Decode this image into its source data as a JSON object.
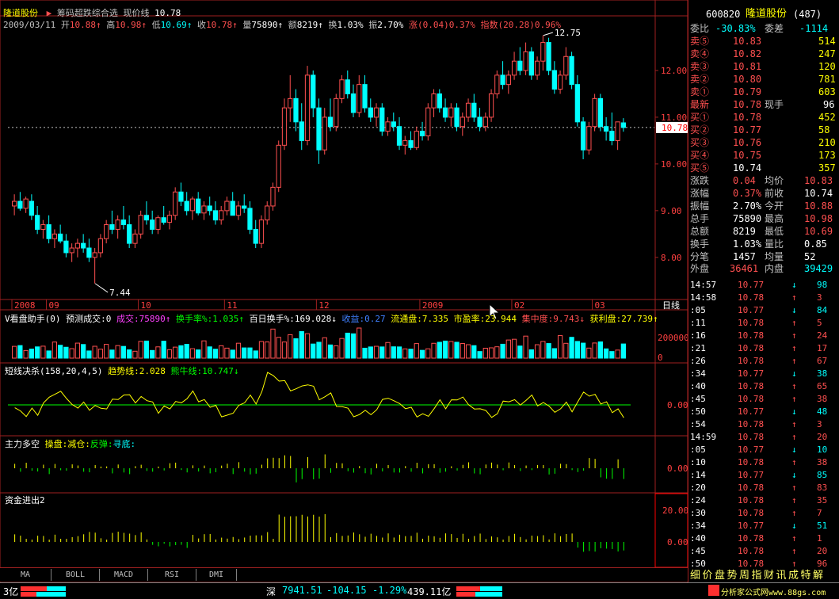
{
  "header": {
    "stock_name": "隆道股份",
    "arrow": "▶",
    "formula_name": "筹码超跌综合选",
    "price_line_label": "现价线",
    "price_line_value": "10.78",
    "date": "2009/03/11",
    "open_label": "开",
    "open": "10.88",
    "high_label": "高",
    "high": "10.98",
    "low_label": "低",
    "low": "10.69",
    "close_label": "收",
    "close": "10.78",
    "vol_label": "量",
    "vol": "75890",
    "amt_label": "额",
    "amt": "8219",
    "turn_label": "换",
    "turn": "1.03%",
    "amp_label": "振",
    "amp": "2.70%",
    "chg_label": "涨",
    "chg": "(0.04)0.37%",
    "idx_label": "指数",
    "idx": "(20.28)0.96%"
  },
  "price_axis": {
    "labels": [
      "12.00",
      "11.00",
      "10.00",
      "9.00",
      "8.00"
    ],
    "current": "10.78"
  },
  "annotations": {
    "high": "12.75",
    "low": "7.44"
  },
  "date_axis": {
    "labels": [
      "2008",
      "09",
      "10",
      "11",
      "12",
      "2009",
      "02",
      "03"
    ],
    "period": "日线"
  },
  "vol_indicator": {
    "name": "V看盘助手(0)",
    "pred_label": "预测成交:0",
    "vol_text": "成交:75890",
    "turn_text": "换手率%:1.035",
    "hundred_text": "百日换手%:169.028",
    "profit_text": "收益:0.27",
    "float_text": "流通盘:7.335",
    "pe_text": "市盈率:23.944",
    "conc_text": "集中度:9.743",
    "win_text": "获利盘:27.739",
    "axis": [
      "200000",
      "0"
    ]
  },
  "short_indicator": {
    "name": "短线决杀(158,20,4,5)",
    "trend_text": "趋势线:2.028",
    "bull_text": "熊牛线:10.747",
    "axis": [
      "0.00"
    ]
  },
  "main_force": {
    "name": "主力多空",
    "legend_a": "操盘:",
    "legend_b": "减仓:",
    "legend_c": "反弹:",
    "legend_d": "寻底:",
    "axis": [
      "0.00"
    ]
  },
  "capital_flow": {
    "name": "资金进出2",
    "axis": [
      "20.00",
      "0.00"
    ]
  },
  "tabs": [
    "MA",
    "BOLL",
    "MACD",
    "RSI",
    "DMI"
  ],
  "quote_panel": {
    "code": "600820",
    "name": "隆道股份",
    "count": "(487)",
    "ratio_label": "委比",
    "ratio": "-30.83%",
    "diff_label": "委差",
    "diff": "-1114",
    "asks": [
      {
        "label": "卖⑤",
        "price": "10.83",
        "vol": "514"
      },
      {
        "label": "卖④",
        "price": "10.82",
        "vol": "247"
      },
      {
        "label": "卖③",
        "price": "10.81",
        "vol": "120"
      },
      {
        "label": "卖②",
        "price": "10.80",
        "vol": "781"
      },
      {
        "label": "卖①",
        "price": "10.79",
        "vol": "603"
      }
    ],
    "last_label": "最新",
    "last": "10.78",
    "hand_label": "现手",
    "hand": "96",
    "bids": [
      {
        "label": "买①",
        "price": "10.78",
        "vol": "452"
      },
      {
        "label": "买②",
        "price": "10.77",
        "vol": "58"
      },
      {
        "label": "买③",
        "price": "10.76",
        "vol": "210"
      },
      {
        "label": "买④",
        "price": "10.75",
        "vol": "173"
      },
      {
        "label": "买⑤",
        "price": "10.74",
        "vol": "357"
      }
    ],
    "stats": [
      {
        "l1": "涨跌",
        "v1": "0.04",
        "l2": "均价",
        "v2": "10.83"
      },
      {
        "l1": "涨幅",
        "v1": "0.37%",
        "l2": "前收",
        "v2": "10.74"
      },
      {
        "l1": "振幅",
        "v1": "2.70%",
        "l2": "今开",
        "v2": "10.88"
      },
      {
        "l1": "总手",
        "v1": "75890",
        "l2": "最高",
        "v2": "10.98"
      },
      {
        "l1": "总额",
        "v1": "8219",
        "l2": "最低",
        "v2": "10.69"
      },
      {
        "l1": "换手",
        "v1": "1.03%",
        "l2": "量比",
        "v2": "0.85"
      },
      {
        "l1": "分笔",
        "v1": "1457",
        "l2": "均量",
        "v2": "52"
      }
    ],
    "outer_label": "外盘",
    "outer": "36461",
    "inner_label": "内盘",
    "inner": "39429"
  },
  "ticks": [
    {
      "t": "14:57",
      "p": "10.77",
      "d": "↓",
      "v": "98"
    },
    {
      "t": "14:58",
      "p": "10.78",
      "d": "↑",
      "v": "3"
    },
    {
      "t": ":05",
      "p": "10.77",
      "d": "↓",
      "v": "84"
    },
    {
      "t": ":11",
      "p": "10.78",
      "d": "↑",
      "v": "5"
    },
    {
      "t": ":16",
      "p": "10.78",
      "d": "↑",
      "v": "24"
    },
    {
      "t": ":21",
      "p": "10.78",
      "d": "↑",
      "v": "17"
    },
    {
      "t": ":26",
      "p": "10.78",
      "d": "↑",
      "v": "67"
    },
    {
      "t": ":34",
      "p": "10.77",
      "d": "↓",
      "v": "38"
    },
    {
      "t": ":40",
      "p": "10.78",
      "d": "↑",
      "v": "65"
    },
    {
      "t": ":45",
      "p": "10.78",
      "d": "↑",
      "v": "38"
    },
    {
      "t": ":50",
      "p": "10.77",
      "d": "↓",
      "v": "48"
    },
    {
      "t": ":54",
      "p": "10.78",
      "d": "↑",
      "v": "3"
    },
    {
      "t": "14:59",
      "p": "10.78",
      "d": "↑",
      "v": "20"
    },
    {
      "t": ":05",
      "p": "10.77",
      "d": "↓",
      "v": "10"
    },
    {
      "t": ":10",
      "p": "10.78",
      "d": "↑",
      "v": "38"
    },
    {
      "t": ":14",
      "p": "10.77",
      "d": "↓",
      "v": "85"
    },
    {
      "t": ":20",
      "p": "10.78",
      "d": "↑",
      "v": "83"
    },
    {
      "t": ":24",
      "p": "10.78",
      "d": "↑",
      "v": "35"
    },
    {
      "t": ":30",
      "p": "10.78",
      "d": "↑",
      "v": "7"
    },
    {
      "t": ":34",
      "p": "10.77",
      "d": "↓",
      "v": "51"
    },
    {
      "t": ":40",
      "p": "10.78",
      "d": "↑",
      "v": "1"
    },
    {
      "t": ":45",
      "p": "10.78",
      "d": "↑",
      "v": "20"
    },
    {
      "t": ":50",
      "p": "10.78",
      "d": "↑",
      "v": "96"
    }
  ],
  "bottom_tabs": [
    "细",
    "价",
    "盘",
    "势",
    "周",
    "指",
    "财",
    "讯",
    "成",
    "特",
    "解"
  ],
  "status": {
    "left": "3亿",
    "market": "深",
    "index": "7941.51",
    "change": "-104.15",
    "pct": "-1.29%",
    "turnover": "439.11亿",
    "site": "分析家公式网www.88gs.com"
  },
  "colors": {
    "up": "#ff5050",
    "down": "#00ffff",
    "grid": "#a02020",
    "yellow": "#ffff00",
    "green": "#00ff00"
  },
  "chart_data": {
    "type": "candlestick",
    "price_range": [
      7.2,
      13.0
    ],
    "candles": [
      [
        9.1,
        9.35,
        8.9,
        9.2
      ],
      [
        9.2,
        9.4,
        9.0,
        9.05
      ],
      [
        9.05,
        9.3,
        8.95,
        9.25
      ],
      [
        9.2,
        9.35,
        8.8,
        8.9
      ],
      [
        8.9,
        9.1,
        8.5,
        8.6
      ],
      [
        8.6,
        8.8,
        8.4,
        8.7
      ],
      [
        8.7,
        8.9,
        8.3,
        8.4
      ],
      [
        8.4,
        8.6,
        8.2,
        8.5
      ],
      [
        8.5,
        8.7,
        8.3,
        8.35
      ],
      [
        8.35,
        8.5,
        8.0,
        8.1
      ],
      [
        8.1,
        8.3,
        7.9,
        8.2
      ],
      [
        8.2,
        8.4,
        8.0,
        8.3
      ],
      [
        8.3,
        8.5,
        8.1,
        8.2
      ],
      [
        8.2,
        8.4,
        7.9,
        8.0
      ],
      [
        8.0,
        8.2,
        7.44,
        8.1
      ],
      [
        8.1,
        8.5,
        8.0,
        8.4
      ],
      [
        8.4,
        8.8,
        8.3,
        8.7
      ],
      [
        8.7,
        9.0,
        8.5,
        8.6
      ],
      [
        8.6,
        8.9,
        8.4,
        8.8
      ],
      [
        8.8,
        9.1,
        8.6,
        8.7
      ],
      [
        8.7,
        8.9,
        8.2,
        8.3
      ],
      [
        8.3,
        8.6,
        8.2,
        8.5
      ],
      [
        8.5,
        9.0,
        8.4,
        8.9
      ],
      [
        8.9,
        9.2,
        8.7,
        8.8
      ],
      [
        8.8,
        9.0,
        8.5,
        8.6
      ],
      [
        8.6,
        8.9,
        8.5,
        8.85
      ],
      [
        8.85,
        9.1,
        8.7,
        8.75
      ],
      [
        8.75,
        9.0,
        8.6,
        8.9
      ],
      [
        8.9,
        9.5,
        8.8,
        9.4
      ],
      [
        9.4,
        9.6,
        9.1,
        9.2
      ],
      [
        9.2,
        9.4,
        8.9,
        9.0
      ],
      [
        9.0,
        9.3,
        8.8,
        9.25
      ],
      [
        9.25,
        9.4,
        8.9,
        8.95
      ],
      [
        8.95,
        9.2,
        8.8,
        9.1
      ],
      [
        9.1,
        9.3,
        8.9,
        9.0
      ],
      [
        9.0,
        9.2,
        8.7,
        8.8
      ],
      [
        8.8,
        9.1,
        8.7,
        9.0
      ],
      [
        9.0,
        9.3,
        8.9,
        9.2
      ],
      [
        9.2,
        9.4,
        8.9,
        8.9
      ],
      [
        8.9,
        9.2,
        8.8,
        9.1
      ],
      [
        9.1,
        9.35,
        8.95,
        9.05
      ],
      [
        9.05,
        9.2,
        8.5,
        8.6
      ],
      [
        8.6,
        8.8,
        8.2,
        8.3
      ],
      [
        8.3,
        8.9,
        8.2,
        8.8
      ],
      [
        8.8,
        9.2,
        8.7,
        9.1
      ],
      [
        9.1,
        9.6,
        9.0,
        9.5
      ],
      [
        9.5,
        10.5,
        9.4,
        10.4
      ],
      [
        10.4,
        11.4,
        10.3,
        11.2
      ],
      [
        11.2,
        11.9,
        10.9,
        11.4
      ],
      [
        11.4,
        11.6,
        10.7,
        10.9
      ],
      [
        10.9,
        11.3,
        10.3,
        10.5
      ],
      [
        10.5,
        12.1,
        10.4,
        11.9
      ],
      [
        11.9,
        12.0,
        11.0,
        11.2
      ],
      [
        11.2,
        11.4,
        10.0,
        10.3
      ],
      [
        10.3,
        11.2,
        10.2,
        11.0
      ],
      [
        11.0,
        11.4,
        10.7,
        10.8
      ],
      [
        10.8,
        11.5,
        10.7,
        11.4
      ],
      [
        11.4,
        11.9,
        11.3,
        11.8
      ],
      [
        11.8,
        12.0,
        11.4,
        11.5
      ],
      [
        11.5,
        11.7,
        11.0,
        11.1
      ],
      [
        11.1,
        11.9,
        11.0,
        11.7
      ],
      [
        11.7,
        11.9,
        11.1,
        11.2
      ],
      [
        11.2,
        11.4,
        10.9,
        11.0
      ],
      [
        11.0,
        11.3,
        10.8,
        11.2
      ],
      [
        11.2,
        11.3,
        10.6,
        10.7
      ],
      [
        10.7,
        11.0,
        10.6,
        10.9
      ],
      [
        10.9,
        11.1,
        10.7,
        10.8
      ],
      [
        10.8,
        11.0,
        10.3,
        10.4
      ],
      [
        10.4,
        10.6,
        10.2,
        10.5
      ],
      [
        10.5,
        10.7,
        10.3,
        10.35
      ],
      [
        10.35,
        10.8,
        10.3,
        10.7
      ],
      [
        10.7,
        10.9,
        10.5,
        10.6
      ],
      [
        10.6,
        11.3,
        10.5,
        11.2
      ],
      [
        11.2,
        11.6,
        11.0,
        11.5
      ],
      [
        11.5,
        11.6,
        11.1,
        11.2
      ],
      [
        11.2,
        11.4,
        10.9,
        11.0
      ],
      [
        11.0,
        11.3,
        10.8,
        11.2
      ],
      [
        11.2,
        11.3,
        10.7,
        10.8
      ],
      [
        10.8,
        11.1,
        10.6,
        11.0
      ],
      [
        11.0,
        11.4,
        10.9,
        11.3
      ],
      [
        11.3,
        11.5,
        10.9,
        11.0
      ],
      [
        11.0,
        11.2,
        10.7,
        10.8
      ],
      [
        10.8,
        11.1,
        10.7,
        11.0
      ],
      [
        11.0,
        11.6,
        10.9,
        11.5
      ],
      [
        11.5,
        12.0,
        11.4,
        11.9
      ],
      [
        11.9,
        12.2,
        11.6,
        11.7
      ],
      [
        11.7,
        12.0,
        11.5,
        11.9
      ],
      [
        11.9,
        12.4,
        11.8,
        12.2
      ],
      [
        12.2,
        12.5,
        11.9,
        12.0
      ],
      [
        12.0,
        12.6,
        11.9,
        12.4
      ],
      [
        12.4,
        12.5,
        11.8,
        11.9
      ],
      [
        11.9,
        12.3,
        11.8,
        12.2
      ],
      [
        12.2,
        12.75,
        12.0,
        12.6
      ],
      [
        12.6,
        12.7,
        11.9,
        12.0
      ],
      [
        12.0,
        12.2,
        11.5,
        11.6
      ],
      [
        11.6,
        12.0,
        11.5,
        11.9
      ],
      [
        11.9,
        12.5,
        11.8,
        12.3
      ],
      [
        12.3,
        12.4,
        11.6,
        11.7
      ],
      [
        11.7,
        11.9,
        10.8,
        10.9
      ],
      [
        10.9,
        11.0,
        10.1,
        10.3
      ],
      [
        10.3,
        10.9,
        10.2,
        10.8
      ],
      [
        10.8,
        11.5,
        10.7,
        11.4
      ],
      [
        11.4,
        11.5,
        10.7,
        10.8
      ],
      [
        10.8,
        11.0,
        10.5,
        10.7
      ],
      [
        10.7,
        11.1,
        10.4,
        10.5
      ],
      [
        10.5,
        10.9,
        10.3,
        10.9
      ],
      [
        10.88,
        10.98,
        10.69,
        10.78
      ]
    ],
    "volume_range": [
      0,
      300000
    ],
    "short_range": [
      -2,
      3
    ],
    "mainforce_range": [
      -1,
      1
    ],
    "capital_range": [
      -10,
      28
    ]
  }
}
